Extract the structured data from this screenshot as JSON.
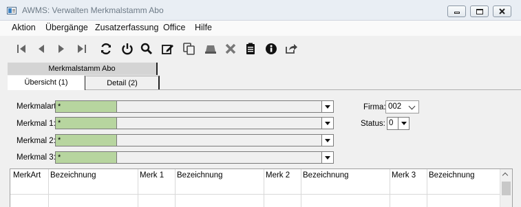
{
  "window": {
    "title": "AWMS: Verwalten Merkmalstamm Abo"
  },
  "menu": [
    "Aktion",
    "Übergänge",
    "Zusatzerfassung",
    "Office",
    "Hilfe"
  ],
  "toolbar_icons": [
    "first-record-icon",
    "previous-record-icon",
    "next-record-icon",
    "last-record-icon",
    "refresh-icon",
    "power-icon",
    "search-icon",
    "edit-icon",
    "copy-icon",
    "eraser-icon",
    "delete-icon",
    "clipboard-icon",
    "info-icon",
    "export-icon"
  ],
  "group_tab": "Merkmalstamm Abo",
  "tabs": [
    "Übersicht (1)",
    "Detail (2)"
  ],
  "filters": [
    {
      "label": "Merkmalart:",
      "value": "*"
    },
    {
      "label": "Merkmal 1:",
      "value": "*"
    },
    {
      "label": "Merkmal 2:",
      "value": "*"
    },
    {
      "label": "Merkmal 3:",
      "value": "*"
    }
  ],
  "firma": {
    "label": "Firma:",
    "value": "002"
  },
  "status": {
    "label": "Status:",
    "value": "0"
  },
  "grid": {
    "columns": [
      "MerkArt",
      "Bezeichnung",
      "Merk 1",
      "Bezeichnung",
      "Merk 2",
      "Bezeichnung",
      "Merk 3",
      "Bezeichnung"
    ]
  },
  "colors": {
    "key_field": "#b7d59f"
  }
}
